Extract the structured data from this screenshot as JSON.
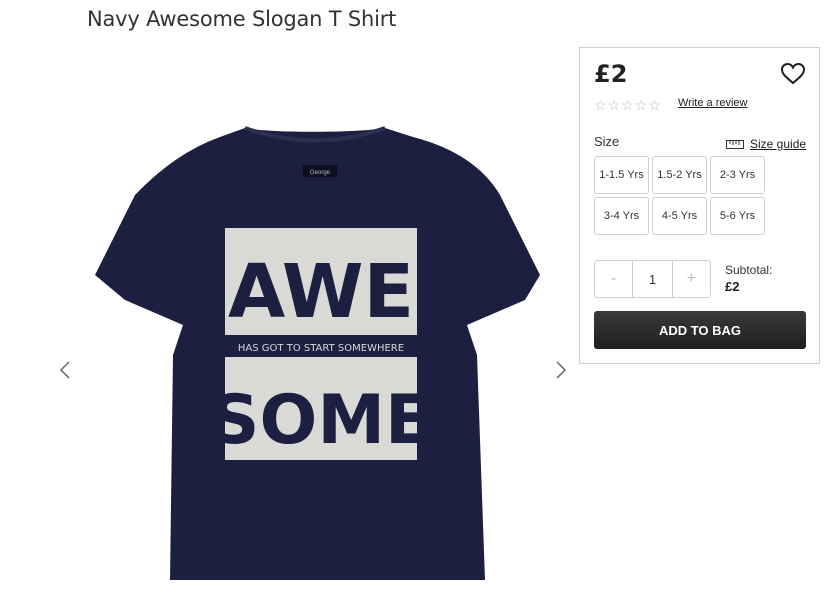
{
  "product": {
    "title": "Navy Awesome Slogan T Shirt",
    "image": {
      "label_text": "George",
      "print_top": "AWE",
      "print_middle": "HAS GOT TO START SOMEWHERE",
      "print_bottom": "SOME",
      "shirt_color": "#1c1f3f"
    }
  },
  "gallery": {
    "prev_icon": "chevron-left-icon",
    "next_icon": "chevron-right-icon"
  },
  "panel": {
    "price": "£2",
    "wishlist_icon": "heart-icon",
    "rating_stars": 5,
    "write_review": "Write a review",
    "size_label": "Size",
    "size_guide": "Size guide",
    "size_guide_icon": "ruler-icon",
    "sizes": [
      "1-1.5 Yrs",
      "1.5-2 Yrs",
      "2-3 Yrs",
      "3-4 Yrs",
      "4-5 Yrs",
      "5-6 Yrs"
    ],
    "quantity": {
      "minus": "-",
      "value": "1",
      "plus": "+"
    },
    "subtotal_label": "Subtotal:",
    "subtotal_value": "£2",
    "add_to_bag": "ADD TO BAG"
  }
}
